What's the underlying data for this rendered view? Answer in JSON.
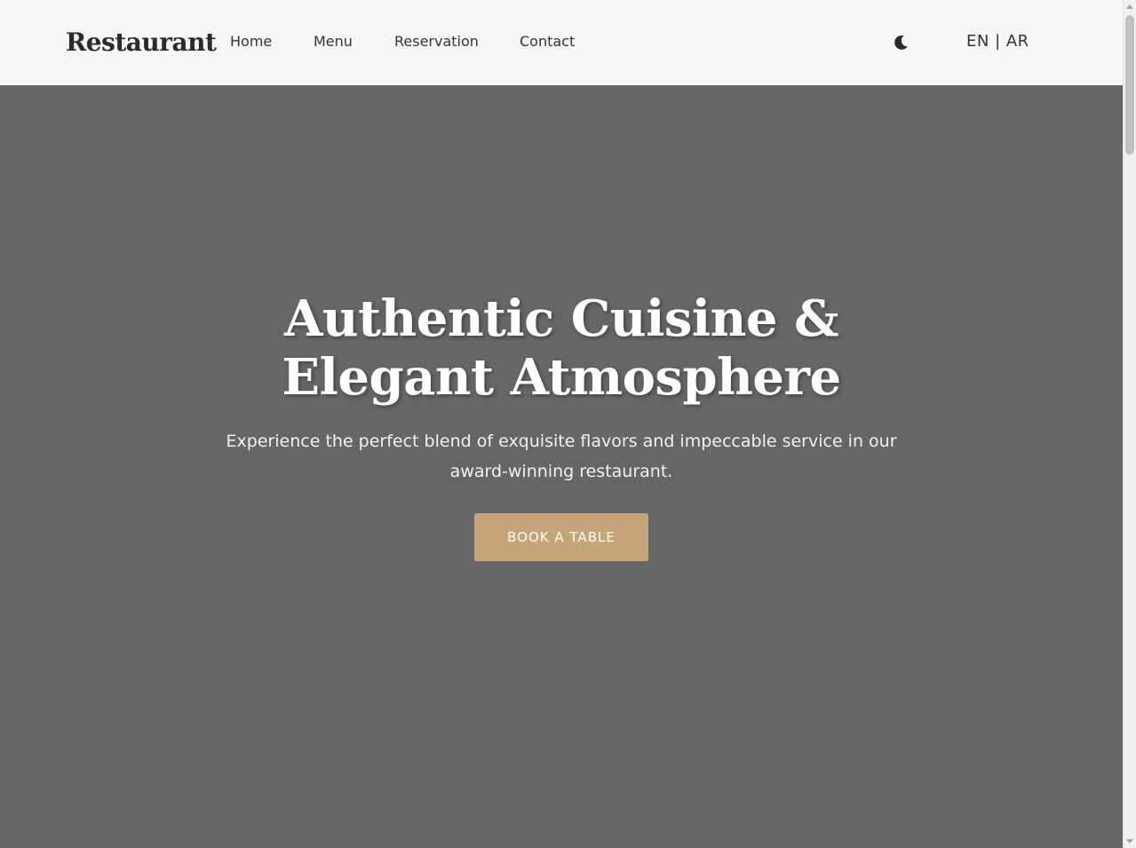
{
  "nav": {
    "brand": "Restaurant",
    "links": [
      {
        "label": "Home"
      },
      {
        "label": "Menu"
      },
      {
        "label": "Reservation"
      },
      {
        "label": "Contact"
      }
    ],
    "theme_toggle_icon": "moon-icon",
    "languages": {
      "en": "EN",
      "separator": " | ",
      "ar": "AR"
    }
  },
  "hero": {
    "title": "Authentic Cuisine & Elegant Atmosphere",
    "subtitle": "Experience the perfect blend of exquisite flavors and impeccable service in our award-winning restaurant.",
    "cta_label": "BOOK A TABLE"
  },
  "colors": {
    "navbar_bg": "#f7f7f7",
    "hero_overlay": "#666666",
    "accent": "#c6a57a",
    "text_dark": "#2b2b2b"
  }
}
